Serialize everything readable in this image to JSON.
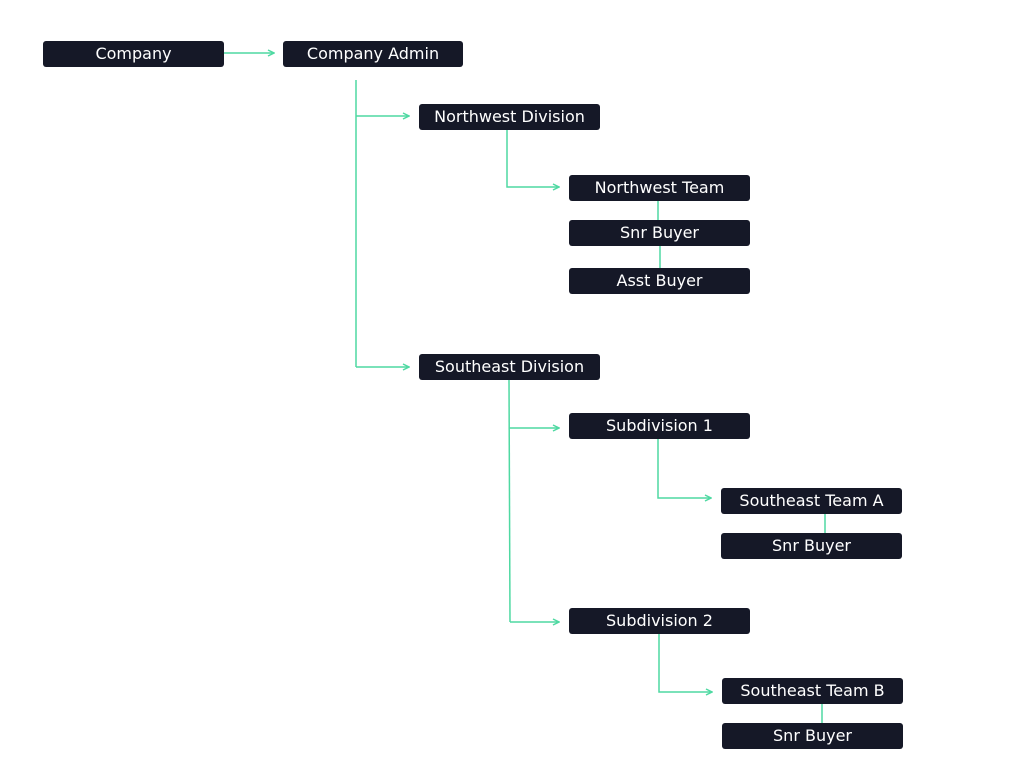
{
  "colors": {
    "node": "#151827",
    "connector": "#4fd9a2",
    "text": "#ffffff"
  },
  "nodes": {
    "company": "Company",
    "company_admin": "Company Admin",
    "northwest_division": "Northwest Division",
    "northwest_team": "Northwest Team",
    "northwest_snr_buyer": "Snr Buyer",
    "northwest_asst_buyer": "Asst Buyer",
    "southeast_division": "Southeast Division",
    "subdivision_1": "Subdivision 1",
    "southeast_team_a": "Southeast Team A",
    "southeast_team_a_snr_buyer": "Snr Buyer",
    "subdivision_2": "Subdivision 2",
    "southeast_team_b": "Southeast Team B",
    "southeast_team_b_snr_buyer": "Snr Buyer"
  }
}
